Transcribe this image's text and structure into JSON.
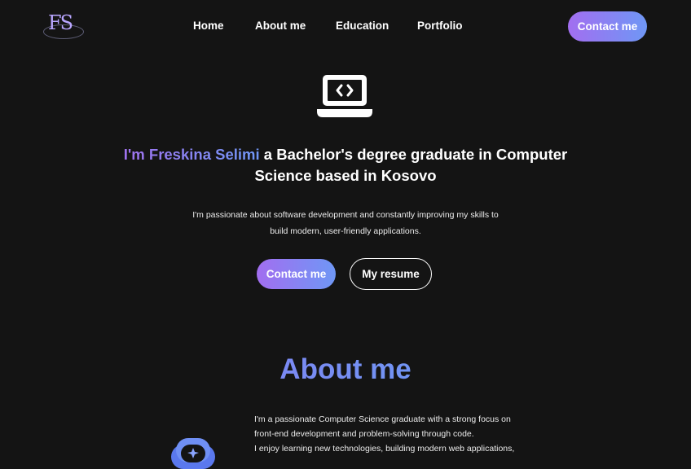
{
  "nav": {
    "logo_letters": "FS",
    "links": [
      "Home",
      "About me",
      "Education",
      "Portfolio"
    ],
    "contact_label": "Contact me"
  },
  "hero": {
    "icon": "laptop-code-icon",
    "title_accent": "I'm Freskina Selimi",
    "title_rest_1": "a Bachelor's degree graduate in Computer",
    "title_rest_2": "Science based in Kosovo",
    "desc_line_1": "I'm passionate about software development and constantly improving my skills to",
    "desc_line_2": "build modern, user-friendly applications.",
    "contact_label": "Contact me",
    "resume_label": "My resume"
  },
  "about": {
    "heading": "About me",
    "avatar_icon": "robot-avatar-icon",
    "lines": [
      "I'm a passionate Computer Science graduate with a strong focus on",
      "front-end development and problem-solving through code.",
      "I enjoy learning new technologies, building modern web applications,"
    ]
  },
  "colors": {
    "background": "#141414",
    "accent_purple": "#a26ef0",
    "accent_blue": "#6f97f5",
    "text": "#ffffff"
  }
}
